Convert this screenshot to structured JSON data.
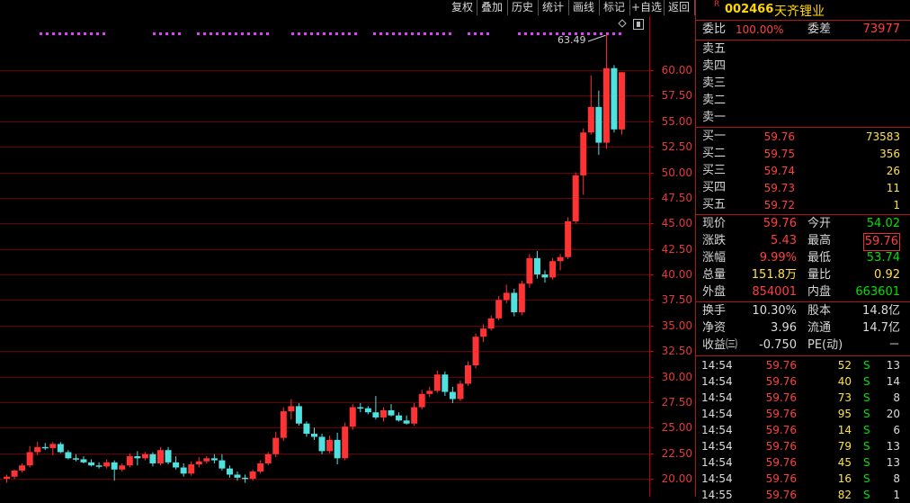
{
  "toolbar": {
    "buttons": [
      "复权",
      "叠加",
      "历史",
      "统计",
      "画线",
      "标记",
      "+自选",
      "返回"
    ]
  },
  "chart": {
    "y_ticks": [
      "60.00",
      "57.50",
      "55.00",
      "52.50",
      "50.00",
      "47.50",
      "45.00",
      "42.50",
      "40.00",
      "37.50",
      "35.00",
      "32.50",
      "30.00",
      "27.50",
      "25.00",
      "22.50",
      "20.00"
    ],
    "high_marker": "63.49",
    "colors": {
      "up": "#ff3333",
      "down": "#4fe0e0",
      "grid": "#6a0000",
      "axis": "#c00000",
      "dots": "#e040ff"
    }
  },
  "chart_data": {
    "type": "candlestick",
    "ylim": [
      19.0,
      63.5
    ],
    "candles": [
      {
        "o": 20.0,
        "h": 20.4,
        "l": 19.6,
        "c": 20.2
      },
      {
        "o": 20.2,
        "h": 20.9,
        "l": 20.0,
        "c": 20.8
      },
      {
        "o": 20.8,
        "h": 21.5,
        "l": 20.6,
        "c": 21.3
      },
      {
        "o": 21.3,
        "h": 23.2,
        "l": 21.1,
        "c": 22.6
      },
      {
        "o": 22.6,
        "h": 23.6,
        "l": 22.3,
        "c": 23.1
      },
      {
        "o": 23.1,
        "h": 23.5,
        "l": 22.8,
        "c": 23.0
      },
      {
        "o": 23.0,
        "h": 23.6,
        "l": 22.3,
        "c": 23.4
      },
      {
        "o": 23.4,
        "h": 23.6,
        "l": 22.5,
        "c": 22.6
      },
      {
        "o": 22.6,
        "h": 22.8,
        "l": 21.9,
        "c": 22.0
      },
      {
        "o": 22.0,
        "h": 22.4,
        "l": 21.7,
        "c": 21.9
      },
      {
        "o": 21.9,
        "h": 22.2,
        "l": 21.5,
        "c": 21.6
      },
      {
        "o": 21.6,
        "h": 21.9,
        "l": 21.2,
        "c": 21.3
      },
      {
        "o": 21.3,
        "h": 21.6,
        "l": 21.0,
        "c": 21.2
      },
      {
        "o": 21.2,
        "h": 21.9,
        "l": 21.0,
        "c": 21.6
      },
      {
        "o": 21.6,
        "h": 21.8,
        "l": 19.8,
        "c": 20.9
      },
      {
        "o": 20.9,
        "h": 21.5,
        "l": 20.7,
        "c": 21.3
      },
      {
        "o": 21.3,
        "h": 22.5,
        "l": 21.1,
        "c": 22.2
      },
      {
        "o": 22.2,
        "h": 22.7,
        "l": 21.3,
        "c": 22.0
      },
      {
        "o": 22.0,
        "h": 22.6,
        "l": 21.8,
        "c": 22.4
      },
      {
        "o": 22.4,
        "h": 22.6,
        "l": 21.2,
        "c": 21.5
      },
      {
        "o": 21.5,
        "h": 23.1,
        "l": 21.3,
        "c": 22.8
      },
      {
        "o": 22.8,
        "h": 23.1,
        "l": 21.4,
        "c": 21.6
      },
      {
        "o": 21.6,
        "h": 22.2,
        "l": 20.9,
        "c": 21.1
      },
      {
        "o": 21.1,
        "h": 21.5,
        "l": 20.2,
        "c": 20.5
      },
      {
        "o": 20.5,
        "h": 21.7,
        "l": 20.3,
        "c": 21.4
      },
      {
        "o": 21.4,
        "h": 22.1,
        "l": 21.1,
        "c": 21.7
      },
      {
        "o": 21.7,
        "h": 22.2,
        "l": 21.5,
        "c": 22.0
      },
      {
        "o": 22.0,
        "h": 22.4,
        "l": 21.5,
        "c": 21.8
      },
      {
        "o": 21.8,
        "h": 22.4,
        "l": 20.8,
        "c": 21.0
      },
      {
        "o": 21.0,
        "h": 21.3,
        "l": 20.1,
        "c": 20.4
      },
      {
        "o": 20.4,
        "h": 20.7,
        "l": 19.8,
        "c": 20.1
      },
      {
        "o": 20.1,
        "h": 20.4,
        "l": 19.6,
        "c": 20.0
      },
      {
        "o": 20.0,
        "h": 20.9,
        "l": 19.8,
        "c": 20.7
      },
      {
        "o": 20.7,
        "h": 21.8,
        "l": 20.5,
        "c": 21.5
      },
      {
        "o": 21.5,
        "h": 22.6,
        "l": 21.3,
        "c": 22.4
      },
      {
        "o": 22.4,
        "h": 24.6,
        "l": 22.1,
        "c": 24.0
      },
      {
        "o": 24.0,
        "h": 27.0,
        "l": 23.7,
        "c": 26.6
      },
      {
        "o": 26.6,
        "h": 27.8,
        "l": 25.8,
        "c": 27.1
      },
      {
        "o": 27.1,
        "h": 27.4,
        "l": 25.2,
        "c": 25.4
      },
      {
        "o": 25.4,
        "h": 25.6,
        "l": 24.1,
        "c": 24.4
      },
      {
        "o": 24.4,
        "h": 25.0,
        "l": 23.8,
        "c": 24.1
      },
      {
        "o": 24.1,
        "h": 24.4,
        "l": 22.4,
        "c": 22.7
      },
      {
        "o": 22.7,
        "h": 24.2,
        "l": 22.5,
        "c": 23.8
      },
      {
        "o": 23.8,
        "h": 24.5,
        "l": 21.4,
        "c": 22.0
      },
      {
        "o": 22.0,
        "h": 25.5,
        "l": 21.8,
        "c": 25.1
      },
      {
        "o": 25.1,
        "h": 27.3,
        "l": 24.8,
        "c": 27.0
      },
      {
        "o": 27.0,
        "h": 27.4,
        "l": 26.5,
        "c": 26.9
      },
      {
        "o": 26.9,
        "h": 27.1,
        "l": 26.3,
        "c": 26.5
      },
      {
        "o": 26.5,
        "h": 28.1,
        "l": 25.8,
        "c": 26.0
      },
      {
        "o": 26.0,
        "h": 27.0,
        "l": 25.6,
        "c": 26.7
      },
      {
        "o": 26.7,
        "h": 27.3,
        "l": 26.1,
        "c": 26.2
      },
      {
        "o": 26.2,
        "h": 26.5,
        "l": 25.6,
        "c": 25.7
      },
      {
        "o": 25.7,
        "h": 26.2,
        "l": 25.3,
        "c": 25.4
      },
      {
        "o": 25.4,
        "h": 27.4,
        "l": 25.2,
        "c": 27.0
      },
      {
        "o": 27.0,
        "h": 28.7,
        "l": 26.8,
        "c": 28.3
      },
      {
        "o": 28.3,
        "h": 29.0,
        "l": 28.0,
        "c": 28.6
      },
      {
        "o": 28.6,
        "h": 30.6,
        "l": 28.4,
        "c": 30.2
      },
      {
        "o": 30.2,
        "h": 30.5,
        "l": 28.1,
        "c": 28.5
      },
      {
        "o": 28.5,
        "h": 29.0,
        "l": 27.4,
        "c": 27.8
      },
      {
        "o": 27.8,
        "h": 29.6,
        "l": 27.6,
        "c": 29.3
      },
      {
        "o": 29.3,
        "h": 31.5,
        "l": 29.1,
        "c": 31.1
      },
      {
        "o": 31.1,
        "h": 34.2,
        "l": 30.8,
        "c": 33.9
      },
      {
        "o": 33.9,
        "h": 35.1,
        "l": 33.4,
        "c": 34.7
      },
      {
        "o": 34.7,
        "h": 36.0,
        "l": 34.5,
        "c": 35.7
      },
      {
        "o": 35.7,
        "h": 37.9,
        "l": 35.5,
        "c": 37.5
      },
      {
        "o": 37.5,
        "h": 39.0,
        "l": 37.2,
        "c": 38.2
      },
      {
        "o": 38.2,
        "h": 38.6,
        "l": 35.9,
        "c": 36.3
      },
      {
        "o": 36.3,
        "h": 39.4,
        "l": 36.0,
        "c": 39.1
      },
      {
        "o": 39.1,
        "h": 42.0,
        "l": 38.7,
        "c": 41.6
      },
      {
        "o": 41.6,
        "h": 42.3,
        "l": 39.6,
        "c": 40.0
      },
      {
        "o": 40.0,
        "h": 40.4,
        "l": 39.2,
        "c": 39.7
      },
      {
        "o": 39.7,
        "h": 41.6,
        "l": 39.5,
        "c": 41.3
      },
      {
        "o": 41.3,
        "h": 42.0,
        "l": 40.4,
        "c": 41.7
      },
      {
        "o": 41.7,
        "h": 45.6,
        "l": 41.5,
        "c": 45.2
      },
      {
        "o": 45.2,
        "h": 50.0,
        "l": 45.0,
        "c": 49.7
      },
      {
        "o": 49.7,
        "h": 54.3,
        "l": 47.8,
        "c": 53.9
      },
      {
        "o": 53.9,
        "h": 59.5,
        "l": 53.7,
        "c": 56.4
      },
      {
        "o": 56.4,
        "h": 58.0,
        "l": 51.7,
        "c": 52.9
      },
      {
        "o": 52.9,
        "h": 63.5,
        "l": 52.3,
        "c": 60.2
      },
      {
        "o": 60.2,
        "h": 60.5,
        "l": 53.9,
        "c": 54.2
      },
      {
        "o": 54.2,
        "h": 59.8,
        "l": 53.7,
        "c": 59.8
      }
    ]
  },
  "header": {
    "r_tag": "R",
    "code": "002466",
    "name": "天齐锂业"
  },
  "ratio": {
    "wb_label": "委比",
    "wb_value": "100.00%",
    "wc_label": "委差",
    "wc_value": "73977"
  },
  "asks": [
    {
      "label": "卖五",
      "price": "",
      "vol": ""
    },
    {
      "label": "卖四",
      "price": "",
      "vol": ""
    },
    {
      "label": "卖三",
      "price": "",
      "vol": ""
    },
    {
      "label": "卖二",
      "price": "",
      "vol": ""
    },
    {
      "label": "卖一",
      "price": "",
      "vol": ""
    }
  ],
  "bids": [
    {
      "label": "买一",
      "price": "59.76",
      "vol": "73583"
    },
    {
      "label": "买二",
      "price": "59.75",
      "vol": "356"
    },
    {
      "label": "买三",
      "price": "59.74",
      "vol": "26"
    },
    {
      "label": "买四",
      "price": "59.73",
      "vol": "11"
    },
    {
      "label": "买五",
      "price": "59.72",
      "vol": "1"
    }
  ],
  "quote": {
    "xj_l": "现价",
    "xj_v": "59.76",
    "jk_l": "今开",
    "jk_v": "54.02",
    "zd_l": "涨跌",
    "zd_v": "5.43",
    "zg_l": "最高",
    "zg_v": "59.76",
    "zf_l": "涨幅",
    "zf_v": "9.99%",
    "zdi_l": "最低",
    "zdi_v": "53.74",
    "zl_l": "总量",
    "zl_v": "151.8万",
    "lb_l": "量比",
    "lb_v": "0.92",
    "wp_l": "外盘",
    "wp_v": "854001",
    "np_l": "内盘",
    "np_v": "663601",
    "hs_l": "换手",
    "hs_v": "10.30%",
    "gb_l": "股本",
    "gb_v": "14.8亿",
    "jz_l": "净资",
    "jz_v": "3.96",
    "lt_l": "流通",
    "lt_v": "14.7亿",
    "sy_l": "收益㈢",
    "sy_v": "-0.750",
    "pe_l": "PE(动)",
    "pe_v": "－"
  },
  "trades": [
    {
      "time": "14:54",
      "price": "59.76",
      "vol": "52",
      "side": "S",
      "n": "13"
    },
    {
      "time": "14:54",
      "price": "59.76",
      "vol": "40",
      "side": "S",
      "n": "14"
    },
    {
      "time": "14:54",
      "price": "59.76",
      "vol": "73",
      "side": "S",
      "n": "8"
    },
    {
      "time": "14:54",
      "price": "59.76",
      "vol": "95",
      "side": "S",
      "n": "20"
    },
    {
      "time": "14:54",
      "price": "59.76",
      "vol": "14",
      "side": "S",
      "n": "6"
    },
    {
      "time": "14:54",
      "price": "59.76",
      "vol": "79",
      "side": "S",
      "n": "13"
    },
    {
      "time": "14:54",
      "price": "59.76",
      "vol": "45",
      "side": "S",
      "n": "13"
    },
    {
      "time": "14:54",
      "price": "59.76",
      "vol": "16",
      "side": "S",
      "n": "8"
    },
    {
      "time": "14:55",
      "price": "59.76",
      "vol": "82",
      "side": "S",
      "n": "1"
    }
  ]
}
